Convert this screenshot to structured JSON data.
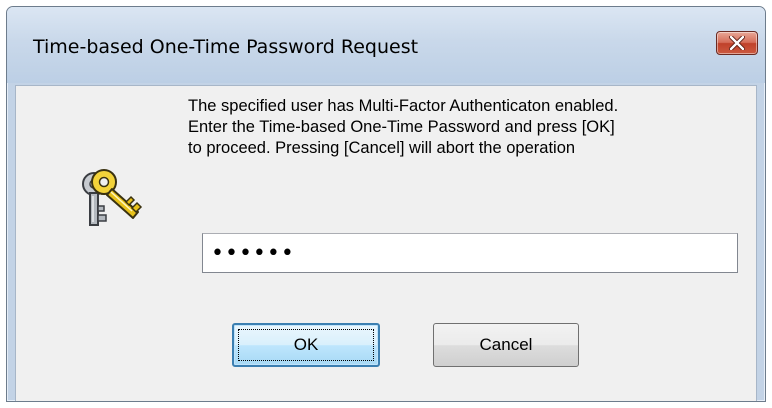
{
  "window": {
    "title": "Time-based One-Time Password Request",
    "close_glyph": "✕"
  },
  "dialog": {
    "message_lines": [
      "The specified user has Multi-Factor Authenticaton enabled.",
      "Enter the Time-based One-Time Password and press [OK]",
      "to proceed. Pressing [Cancel] will abort the operation"
    ],
    "icon": "keys-icon",
    "password_value": "●●●●●●",
    "ok_label": "OK",
    "cancel_label": "Cancel"
  },
  "colors": {
    "client_background": "#f0f0f0",
    "titlebar": "#c9d8ea",
    "close_button": "#c0412a",
    "key_gold": "#e8c21a",
    "key_silver": "#8a8f96"
  }
}
